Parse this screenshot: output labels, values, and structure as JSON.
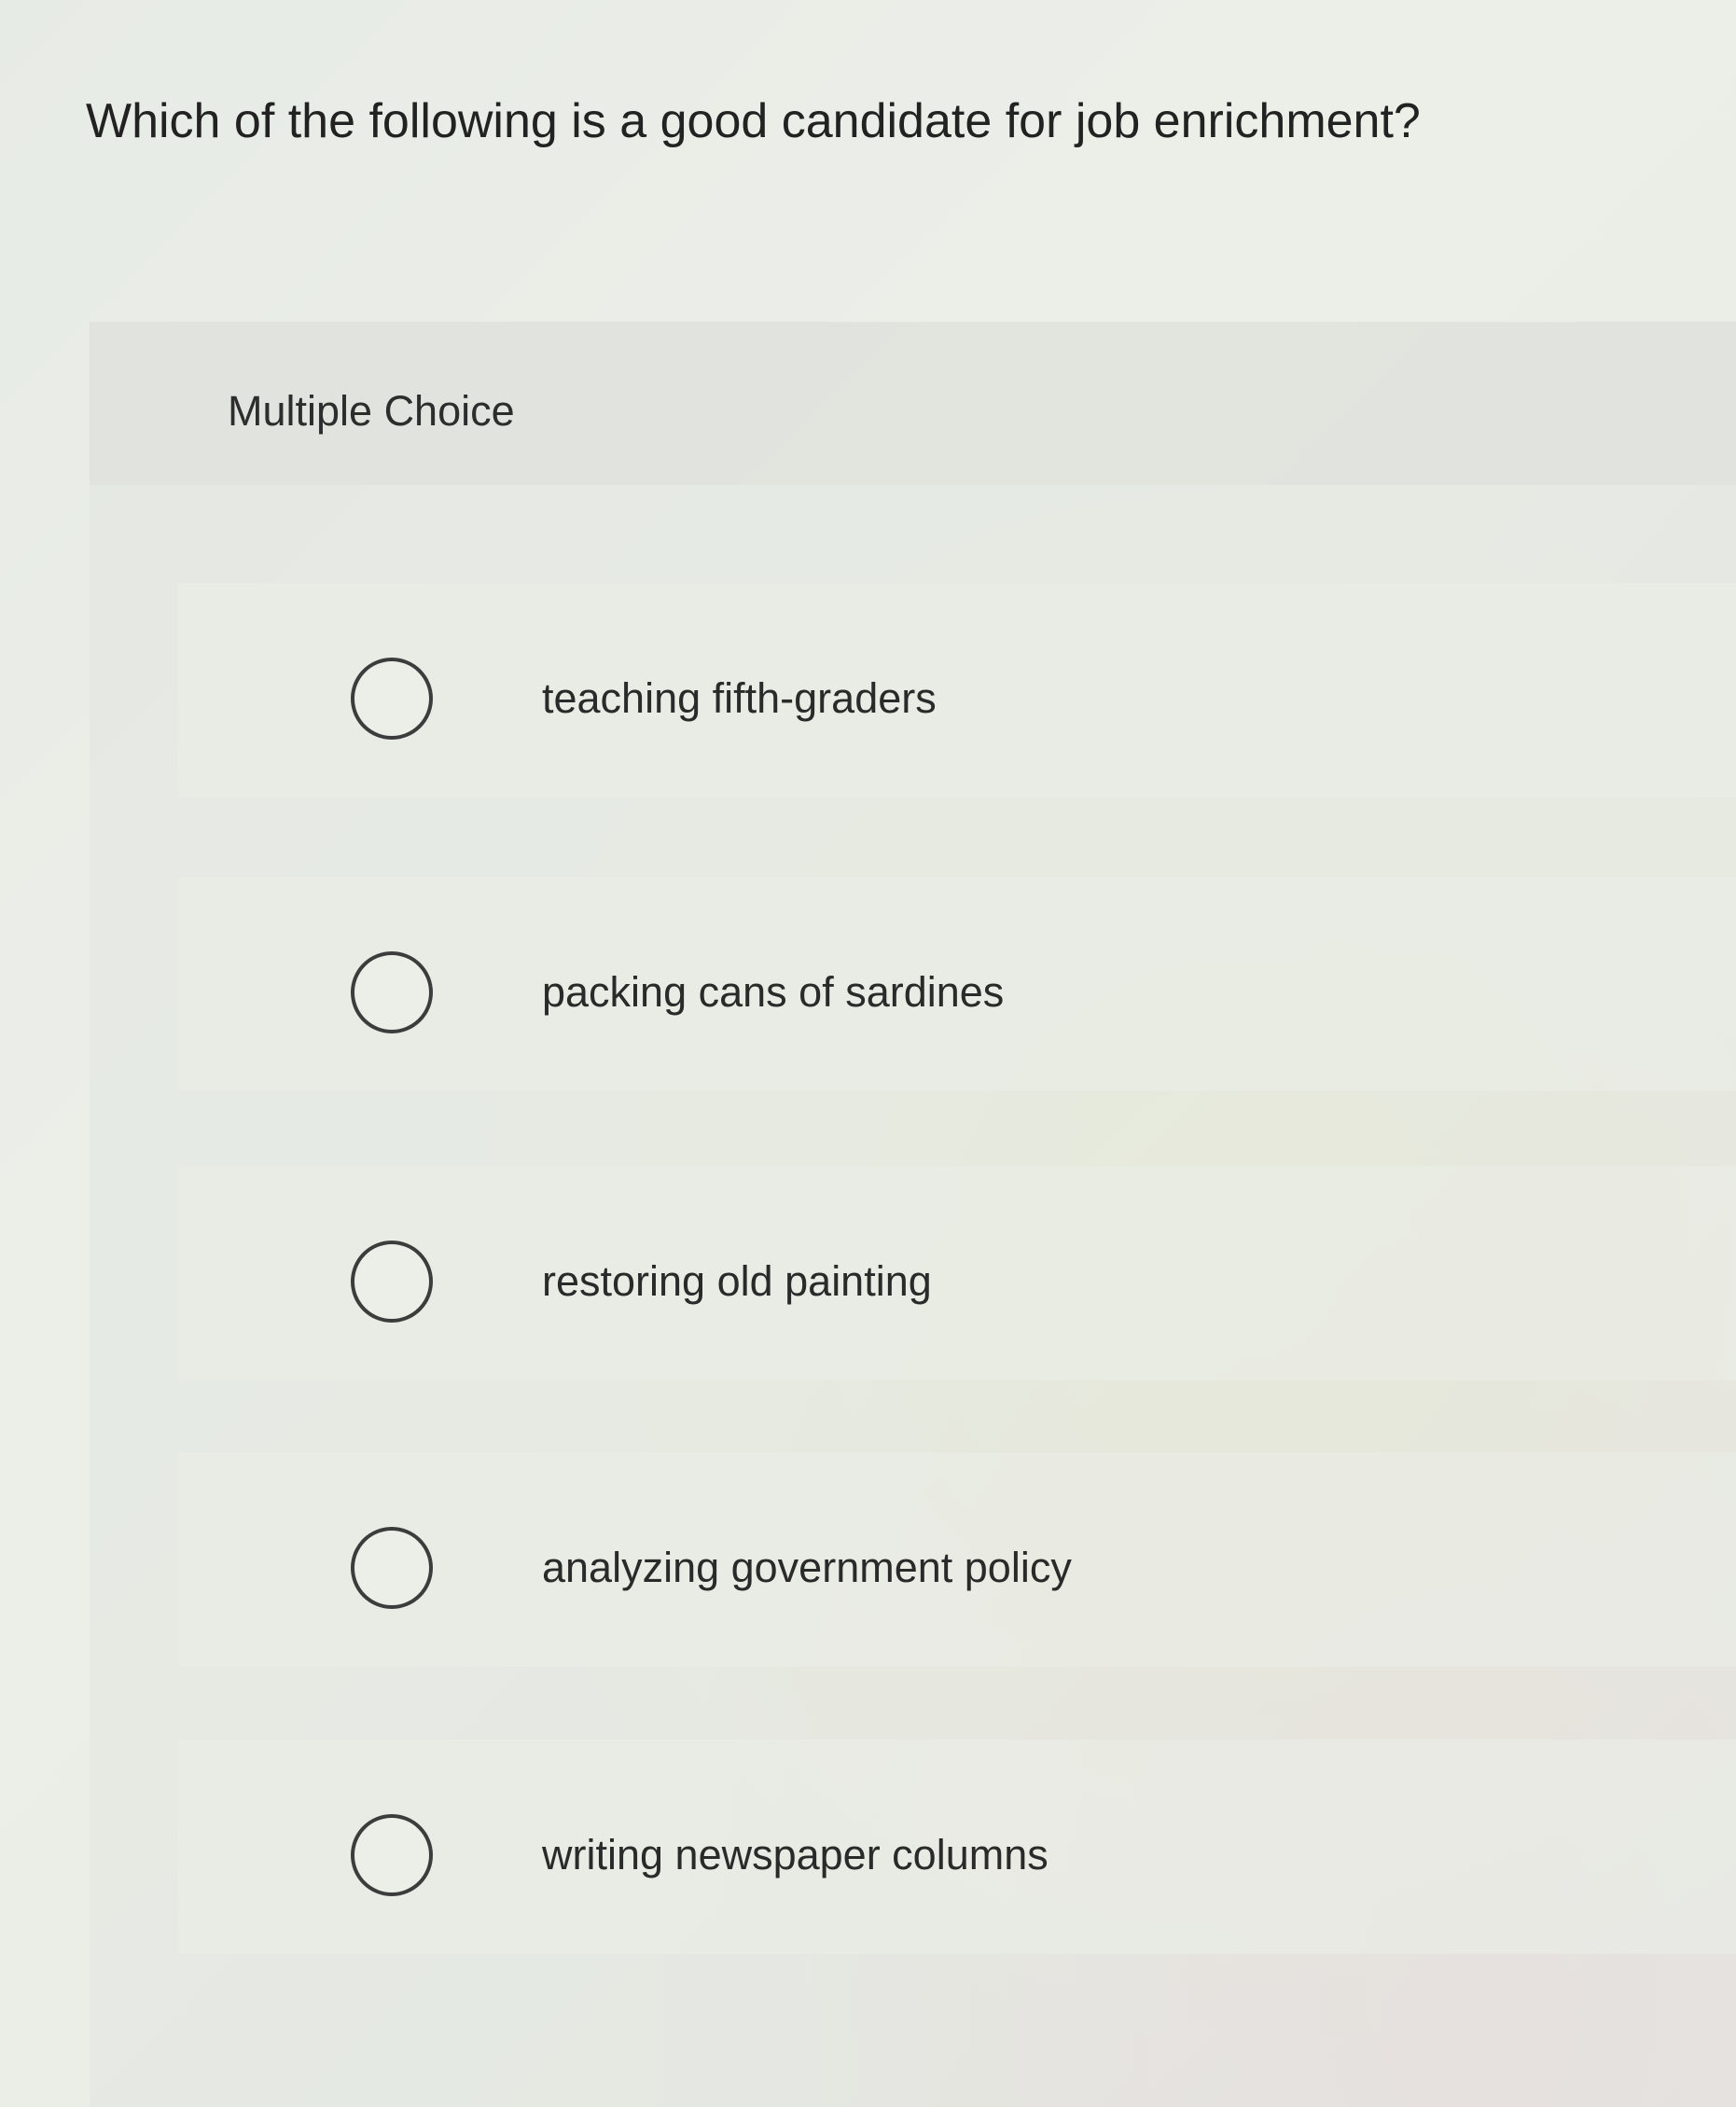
{
  "question": {
    "text": "Which of the following is a good candidate for job enrichment?"
  },
  "answer_panel": {
    "type_label": "Multiple Choice",
    "options": [
      {
        "label": "teaching fifth-graders",
        "selected": false
      },
      {
        "label": "packing cans of sardines",
        "selected": false
      },
      {
        "label": "restoring old painting",
        "selected": false
      },
      {
        "label": "analyzing government policy",
        "selected": false
      },
      {
        "label": "writing newspaper columns",
        "selected": false
      }
    ]
  },
  "icons": {
    "radio": "radio-button-unchecked-icon"
  },
  "colors": {
    "text": "#2a2a2a",
    "radio_border": "#3c3c3c"
  }
}
